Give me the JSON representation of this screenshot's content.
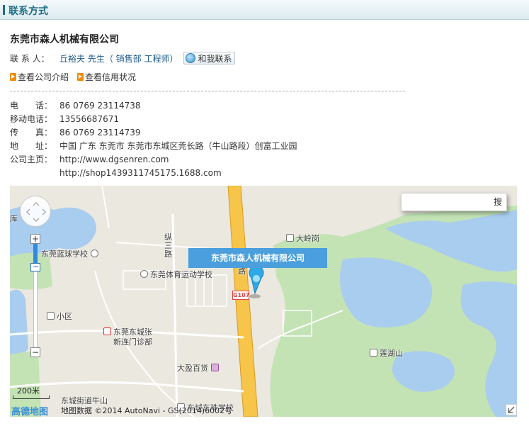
{
  "header": {
    "title": "联系方式"
  },
  "company": {
    "name": "东莞市森人机械有限公司"
  },
  "contact": {
    "label": "联 系 人：",
    "name": "丘裕夫 先生（ 销售部 工程师）",
    "chat_button": "和我联系"
  },
  "links": [
    {
      "label": "查看公司介绍"
    },
    {
      "label": "查看信用状况"
    }
  ],
  "info": {
    "phone": {
      "label": "电　　话：",
      "value": "86 0769 23114738"
    },
    "mobile": {
      "label": "移动电话：",
      "value": "13556687671"
    },
    "fax": {
      "label": "传　　真：",
      "value": "86 0769 23114739"
    },
    "address": {
      "label": "地　　址：",
      "value": "中国 广东 东莞市 东莞市东城区莞长路（牛山路段）创富工业园"
    },
    "homepage": {
      "label": "公司主页：",
      "urls": [
        "http://www.dgsenren.com",
        "http://shop1439311745175.1688.com"
      ]
    }
  },
  "map": {
    "search_button": "搜",
    "callout": "东莞市森人机械有限公司",
    "road_shield": "G107",
    "labels": {
      "lake_edge": "库",
      "basketball_school": "东莞蓝球学校",
      "sports_school": "东莞体育运动学校",
      "community": "小区",
      "clinic_line1": "东莞东城张",
      "clinic_line2": "新连门诊部",
      "dayinghuo": "大盈百货",
      "dalinggang": "大岭岗",
      "lianhushan": "莲湖山",
      "street_zong": "纵",
      "street_san": "三",
      "street_lu": "路",
      "road_lu": "路",
      "bottom_school": "东城东珠学校",
      "bottom_left_partial": "东城街道牛山"
    },
    "scale": "200米",
    "brand": "高德地图",
    "copyright": "地图数据 ©2014 AutoNavi - GS(2014)6002号"
  }
}
